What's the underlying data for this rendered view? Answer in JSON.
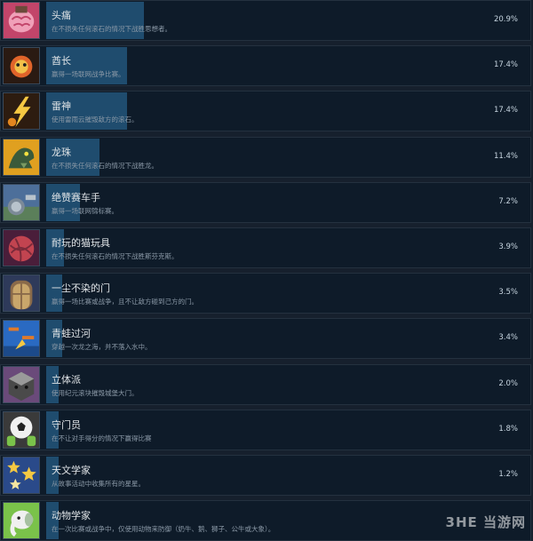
{
  "achievements": [
    {
      "title": "头痛",
      "description": "在不损失任何滚石的情况下战胜思想者。",
      "percent_label": "20.9%",
      "percent": 20.9,
      "icon": "brain-icon",
      "icon_colors": [
        "#c2456a",
        "#f0a0b8",
        "#6b4a3a"
      ]
    },
    {
      "title": "酋长",
      "description": "赢得一场联网战争比赛。",
      "percent_label": "17.4%",
      "percent": 17.4,
      "icon": "chief-icon",
      "icon_colors": [
        "#2a1a12",
        "#e0642a",
        "#f2c14a"
      ]
    },
    {
      "title": "雷神",
      "description": "使用雷雨云摧毁敌方的滚石。",
      "percent_label": "17.4%",
      "percent": 17.4,
      "icon": "lightning-icon",
      "icon_colors": [
        "#2d1c10",
        "#f5c842",
        "#e2861f"
      ]
    },
    {
      "title": "龙珠",
      "description": "在不损失任何滚石的情况下战胜龙。",
      "percent_label": "11.4%",
      "percent": 11.4,
      "icon": "dragon-icon",
      "icon_colors": [
        "#e0a020",
        "#3a5a3a",
        "#7a9a62"
      ]
    },
    {
      "title": "绝赞赛车手",
      "description": "赢得一场联网锦标赛。",
      "percent_label": "7.2%",
      "percent": 7.2,
      "icon": "race-icon",
      "icon_colors": [
        "#4d6f9a",
        "#b8c3cc",
        "#7c8a98"
      ]
    },
    {
      "title": "耐玩的猫玩具",
      "description": "在不损失任何滚石的情况下战胜斯芬克斯。",
      "percent_label": "3.9%",
      "percent": 3.9,
      "icon": "yarn-ball-icon",
      "icon_colors": [
        "#4a1e3a",
        "#c24450",
        "#7a2a3a"
      ]
    },
    {
      "title": "一尘不染的门",
      "description": "赢得一场比赛或战争，且不让敌方碰到己方的门。",
      "percent_label": "3.5%",
      "percent": 3.5,
      "icon": "door-icon",
      "icon_colors": [
        "#2e3a5a",
        "#8a6a4a",
        "#c9a66b"
      ]
    },
    {
      "title": "青蛙过河",
      "description": "穿越一次龙之海，并不落入水中。",
      "percent_label": "3.4%",
      "percent": 3.4,
      "icon": "frog-icon",
      "icon_colors": [
        "#2a6ac2",
        "#e07a2a",
        "#f5c842"
      ]
    },
    {
      "title": "立体派",
      "description": "使用纪元滚块摧毁城堡大门。",
      "percent_label": "2.0%",
      "percent": 2.0,
      "icon": "cube-icon",
      "icon_colors": [
        "#6a4a7a",
        "#4a4a4a",
        "#9a9a9a"
      ]
    },
    {
      "title": "守门员",
      "description": "在不让对手得分的情况下赢得比赛",
      "percent_label": "1.8%",
      "percent": 1.8,
      "icon": "goalkeeper-icon",
      "icon_colors": [
        "#3a3a3a",
        "#f0f0f0",
        "#7ac24a"
      ]
    },
    {
      "title": "天文学家",
      "description": "从故事活动中收集所有的星星。",
      "percent_label": "1.2%",
      "percent": 1.2,
      "icon": "stars-icon",
      "icon_colors": [
        "#2a4a8a",
        "#f5c842",
        "#f5e6a0"
      ]
    },
    {
      "title": "动物学家",
      "description": "在一次比赛或战争中，仅使用动物来防御（奶牛、鹅、狮子、公牛或大象）。",
      "percent_label": "",
      "percent": 0.8,
      "icon": "elephant-icon",
      "icon_colors": [
        "#7ac24a",
        "#f0f0f0",
        "#3a7a2a"
      ]
    }
  ],
  "watermark": "3HE 当游网"
}
